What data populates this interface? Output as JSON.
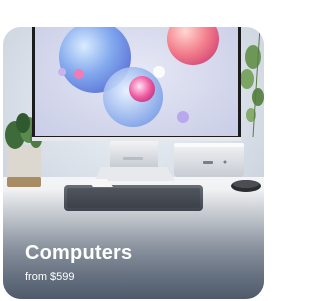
{
  "card": {
    "title": "Computers",
    "price": "from $599"
  },
  "colors": {
    "title_text": "#ffffff",
    "screen_bezel": "#1c1c1e",
    "display_wallpaper_base": "#dcdff2"
  },
  "icons": [
    "display-icon",
    "mac-studio-icon",
    "keyboard-icon",
    "mouse-icon",
    "plant-icon"
  ]
}
